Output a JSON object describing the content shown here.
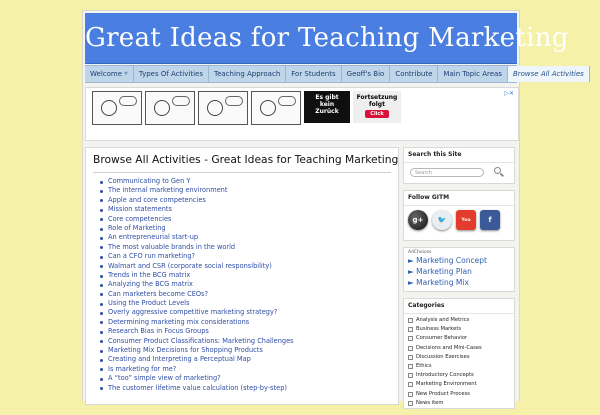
{
  "site": {
    "title": "Great Ideas for Teaching Marketing"
  },
  "nav": {
    "items": [
      {
        "label": "Welcome",
        "has_caret": true
      },
      {
        "label": "Types Of Activities"
      },
      {
        "label": "Teaching Approach"
      },
      {
        "label": "For Students"
      },
      {
        "label": "Geoff's Bio"
      },
      {
        "label": "Contribute"
      },
      {
        "label": "Main Topic Areas"
      },
      {
        "label": "Browse All Activities",
        "active": true
      }
    ]
  },
  "ad": {
    "banner_line1": "Es gibt",
    "banner_line2": "kein",
    "banner_line3": "Zurück",
    "promo_line1": "Fortsetzung",
    "promo_line2": "folgt",
    "promo_button": "Click"
  },
  "main": {
    "heading": "Browse All Activities - Great Ideas for Teaching Marketing",
    "activities": [
      "Communicating to Gen Y",
      "The internal marketing environment",
      "Apple and core competencies",
      "Mission statements",
      "Core competencies",
      "Role of Marketing",
      "An entrepreneurial start-up",
      "The most valuable brands in the world",
      "Can a CFO run marketing?",
      "Walmart and CSR (corporate social responsibility)",
      "Trends in the BCG matrix",
      "Analyzing the BCG matrix",
      "Can marketers become CEOs?",
      "Using the Product Levels",
      "Overly aggressive competitive marketing strategy?",
      "Determining marketing mix considerations",
      "Research Bias in Focus Groups",
      "Consumer Product Classifications: Marketing Challenges",
      "Marketing Mix Decisions for Shopping Products",
      "Creating and Interpreting a Perceptual Map",
      "Is marketing for me?",
      "A “too” simple view of marketing?",
      "The customer lifetime value calculation (step-by-step)"
    ]
  },
  "sidebar": {
    "search_title": "Search this Site",
    "search_placeholder": "Search",
    "follow_title": "Follow GITM",
    "social": [
      {
        "icon": "google-plus-icon",
        "glyph": "g+"
      },
      {
        "icon": "twitter-icon",
        "glyph": "🐦"
      },
      {
        "icon": "youtube-icon",
        "glyph": "You"
      },
      {
        "icon": "facebook-icon",
        "glyph": "f"
      }
    ],
    "adchoices_label": "AdChoices",
    "ad_links": [
      "► Marketing Concept",
      "► Marketing Plan",
      "► Marketing Mix"
    ],
    "categories_title": "Categories",
    "categories": [
      "Analysis and Metrics",
      "Business Markets",
      "Consumer Behavior",
      "Decisions and Mini-Cases",
      "Discussion Exercises",
      "Ethics",
      "Introductory Concepts",
      "Marketing Environment",
      "New Product Process",
      "News item"
    ]
  },
  "colors": {
    "page_bg": "#f6f1a8",
    "banner": "#4a7ee0",
    "nav_bg": "#bfd6ea",
    "link": "#2f4ea6"
  }
}
